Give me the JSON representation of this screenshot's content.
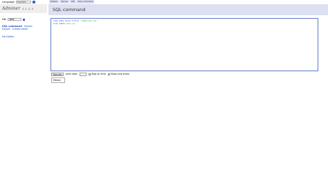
{
  "top": {
    "language_label": "Language",
    "language_value": "English",
    "breadcrumbs": [
      "MySQL",
      "Server",
      "DB",
      "SQL command"
    ]
  },
  "sidebar": {
    "logo": "Adminer",
    "version": "4.1.4.0",
    "db_label": "DB:",
    "db_value": "test",
    "nav": {
      "sql_command": "SQL command",
      "import": "Import",
      "export": "Export",
      "create_table": "Create table"
    },
    "no_tables": "No tables."
  },
  "main": {
    "title": "SQL command",
    "editor": {
      "line1_kw1": "load data",
      "line1_kw2": "local",
      "line1_kw3": "infile",
      "line1_str": "'/tmp/list.csv'",
      "line2_kw": "into table",
      "line2_val": "test.csv"
    },
    "execute_label": "Execute",
    "limit_label": "Limit rows:",
    "stop_on_error_label": "Stop on error",
    "show_errors_label": "Show only errors",
    "history_label": "History"
  }
}
